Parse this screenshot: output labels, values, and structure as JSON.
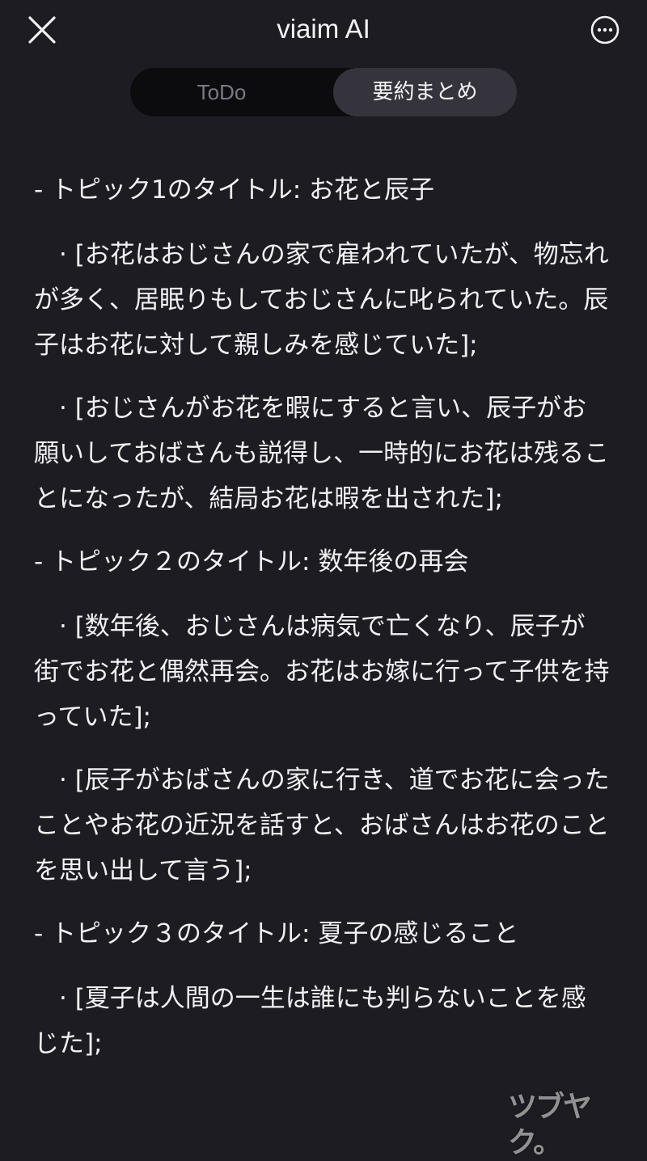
{
  "header": {
    "title": "viaim AI",
    "close_icon": "close-icon",
    "more_icon": "more-horizontal-circle-icon"
  },
  "tabs": [
    {
      "label": "ToDo",
      "selected": false
    },
    {
      "label": "要約まとめ",
      "selected": true
    }
  ],
  "summary": [
    {
      "kind": "topic",
      "text": "- トピック1のタイトル: お花と辰子"
    },
    {
      "kind": "point",
      "text": "　· [お花はおじさんの家で雇われていたが、物忘れが多く、居眠りもしておじさんに叱られていた。辰子はお花に対して親しみを感じていた];"
    },
    {
      "kind": "point",
      "text": "　· [おじさんがお花を暇にすると言い、辰子がお願いしておばさんも説得し、一時的にお花は残ることになったが、結局お花は暇を出された];"
    },
    {
      "kind": "topic",
      "text": "- トピック２のタイトル: 数年後の再会"
    },
    {
      "kind": "point",
      "text": "　· [数年後、おじさんは病気で亡くなり、辰子が街でお花と偶然再会。お花はお嫁に行って子供を持っていた];"
    },
    {
      "kind": "point",
      "text": "　· [辰子がおばさんの家に行き、道でお花に会ったことやお花の近況を話すと、おばさんはお花のことを思い出して言う];"
    },
    {
      "kind": "topic",
      "text": "- トピック３のタイトル: 夏子の感じること"
    },
    {
      "kind": "point",
      "text": "　· [夏子は人間の一生は誰にも判らないことを感じた];"
    }
  ],
  "watermark": "ツブヤク。",
  "colors": {
    "background": "#1c1c22",
    "segment_track": "#0c0c0f",
    "segment_selected": "#35343d",
    "text": "#f2f2f4",
    "text_muted": "#7b7b84"
  }
}
